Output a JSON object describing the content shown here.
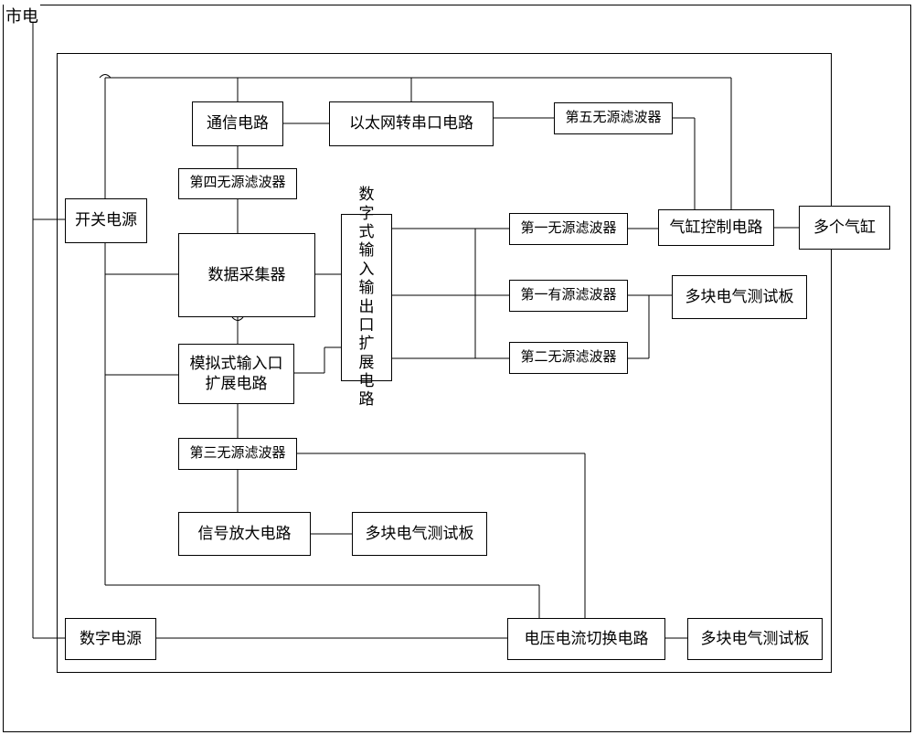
{
  "top_label": "市电",
  "boxes": {
    "switch_power": "开关电源",
    "comm_circuit": "通信电路",
    "ethernet_serial": "以太网转串口电路",
    "filter5": "第五无源滤波器",
    "filter4": "第四无源滤波器",
    "data_collector": "数据采集器",
    "digital_io": "数字式输入输出口扩展电路",
    "filter1": "第一无源滤波器",
    "cylinder_control": "气缸控制电路",
    "multi_cylinder": "多个气缸",
    "active_filter1": "第一有源滤波器",
    "filter2": "第二无源滤波器",
    "test_board_right": "多块电气测试板",
    "analog_input": "模拟式输入口扩展电路",
    "filter3": "第三无源滤波器",
    "signal_amp": "信号放大电路",
    "test_board_mid": "多块电气测试板",
    "digital_power": "数字电源",
    "voltage_current": "电压电流切换电路",
    "test_board_bottom": "多块电气测试板"
  }
}
